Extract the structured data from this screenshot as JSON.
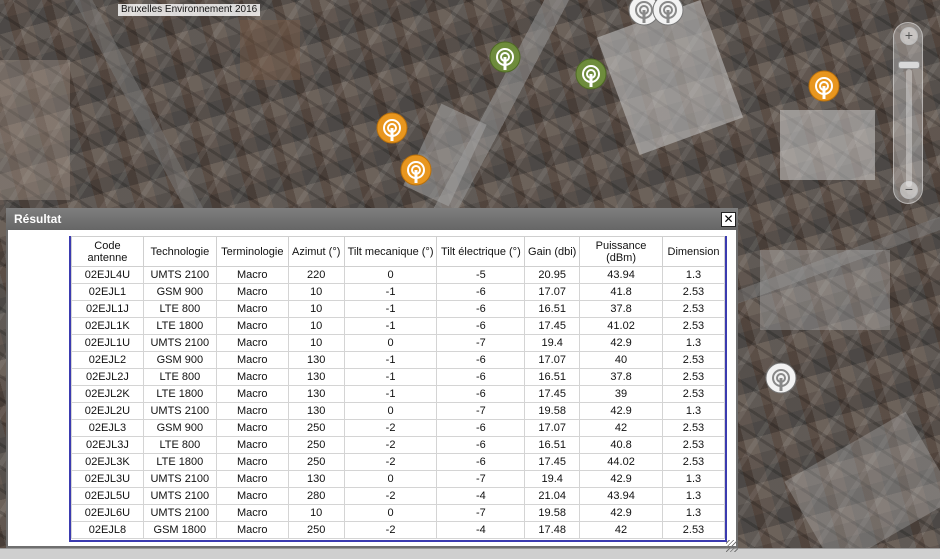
{
  "map": {
    "attribution": "Bruxelles Environnement 2016",
    "markers": [
      {
        "type": "white",
        "icon": "antenna-icon"
      },
      {
        "type": "white",
        "icon": "antenna-icon"
      },
      {
        "type": "green",
        "icon": "antenna-icon"
      },
      {
        "type": "green",
        "icon": "antenna-icon"
      },
      {
        "type": "orange",
        "icon": "antenna-icon"
      },
      {
        "type": "orange",
        "icon": "antenna-icon"
      },
      {
        "type": "orange",
        "icon": "antenna-icon"
      },
      {
        "type": "white",
        "icon": "antenna-icon"
      }
    ],
    "zoom": {
      "in_label": "+",
      "out_label": "−"
    }
  },
  "colors": {
    "marker_orange": "#e8961e",
    "marker_green": "#6e8c3c",
    "marker_white": "#f2f2f2",
    "titlebar": "#6e6e6e",
    "table_border": "#3b3bb0"
  },
  "result": {
    "title": "Résultat",
    "close_label": "✕",
    "columns": [
      "Code antenne",
      "Technologie",
      "Terminologie",
      "Azimut (°)",
      "Tilt mecanique (°)",
      "Tilt électrique (°)",
      "Gain (dbi)",
      "Puissance (dBm)",
      "Dimension"
    ],
    "rows": [
      [
        "02EJL4U",
        "UMTS 2100",
        "Macro",
        "220",
        "0",
        "-5",
        "20.95",
        "43.94",
        "1.3"
      ],
      [
        "02EJL1",
        "GSM 900",
        "Macro",
        "10",
        "-1",
        "-6",
        "17.07",
        "41.8",
        "2.53"
      ],
      [
        "02EJL1J",
        "LTE 800",
        "Macro",
        "10",
        "-1",
        "-6",
        "16.51",
        "37.8",
        "2.53"
      ],
      [
        "02EJL1K",
        "LTE 1800",
        "Macro",
        "10",
        "-1",
        "-6",
        "17.45",
        "41.02",
        "2.53"
      ],
      [
        "02EJL1U",
        "UMTS 2100",
        "Macro",
        "10",
        "0",
        "-7",
        "19.4",
        "42.9",
        "1.3"
      ],
      [
        "02EJL2",
        "GSM 900",
        "Macro",
        "130",
        "-1",
        "-6",
        "17.07",
        "40",
        "2.53"
      ],
      [
        "02EJL2J",
        "LTE 800",
        "Macro",
        "130",
        "-1",
        "-6",
        "16.51",
        "37.8",
        "2.53"
      ],
      [
        "02EJL2K",
        "LTE 1800",
        "Macro",
        "130",
        "-1",
        "-6",
        "17.45",
        "39",
        "2.53"
      ],
      [
        "02EJL2U",
        "UMTS 2100",
        "Macro",
        "130",
        "0",
        "-7",
        "19.58",
        "42.9",
        "1.3"
      ],
      [
        "02EJL3",
        "GSM 900",
        "Macro",
        "250",
        "-2",
        "-6",
        "17.07",
        "42",
        "2.53"
      ],
      [
        "02EJL3J",
        "LTE 800",
        "Macro",
        "250",
        "-2",
        "-6",
        "16.51",
        "40.8",
        "2.53"
      ],
      [
        "02EJL3K",
        "LTE 1800",
        "Macro",
        "250",
        "-2",
        "-6",
        "17.45",
        "44.02",
        "2.53"
      ],
      [
        "02EJL3U",
        "UMTS 2100",
        "Macro",
        "130",
        "0",
        "-7",
        "19.4",
        "42.9",
        "1.3"
      ],
      [
        "02EJL5U",
        "UMTS 2100",
        "Macro",
        "280",
        "-2",
        "-4",
        "21.04",
        "43.94",
        "1.3"
      ],
      [
        "02EJL6U",
        "UMTS 2100",
        "Macro",
        "10",
        "0",
        "-7",
        "19.58",
        "42.9",
        "1.3"
      ],
      [
        "02EJL8",
        "GSM 1800",
        "Macro",
        "250",
        "-2",
        "-4",
        "17.48",
        "42",
        "2.53"
      ]
    ]
  }
}
